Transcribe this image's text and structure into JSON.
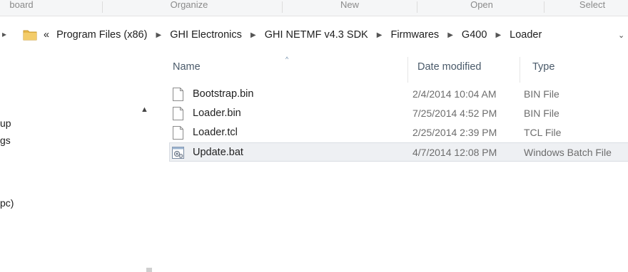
{
  "ribbon": {
    "groups": [
      "board",
      "Organize",
      "New",
      "Open",
      "Select"
    ]
  },
  "address": {
    "overflow_label": "«",
    "crumbs": [
      "Program Files (x86)",
      "GHI Electronics",
      "GHI NETMF v4.3 SDK",
      "Firmwares",
      "G400",
      "Loader"
    ]
  },
  "nav": {
    "items": [
      "up",
      "gs",
      "pc)"
    ]
  },
  "columns": {
    "name": "Name",
    "date_modified": "Date modified",
    "type": "Type"
  },
  "files": [
    {
      "name": "Bootstrap.bin",
      "date": "2/4/2014 10:04 AM",
      "type": "BIN File",
      "icon": "blank-file-icon"
    },
    {
      "name": "Loader.bin",
      "date": "7/25/2014 4:52 PM",
      "type": "BIN File",
      "icon": "blank-file-icon"
    },
    {
      "name": "Loader.tcl",
      "date": "2/25/2014 2:39 PM",
      "type": "TCL File",
      "icon": "blank-file-icon"
    },
    {
      "name": "Update.bat",
      "date": "4/7/2014 12:08 PM",
      "type": "Windows Batch File",
      "icon": "batch-file-icon",
      "selected": true
    }
  ],
  "colors": {
    "folder": "#e8b84a",
    "selection": "#eef0f3",
    "header_text": "#4a5a6a"
  }
}
